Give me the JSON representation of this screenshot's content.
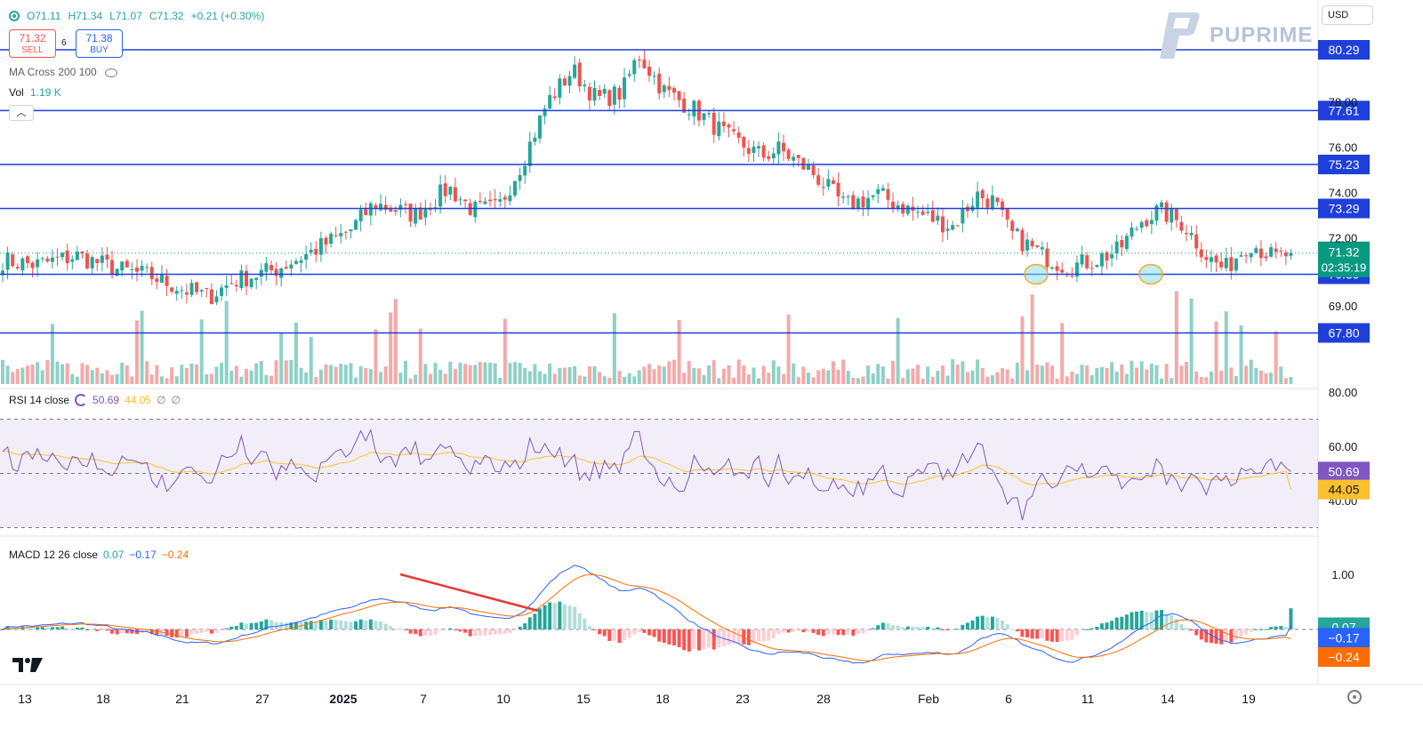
{
  "symbol_bar": {
    "ohlc": [
      "O71.11",
      "H71.34",
      "L71.07",
      "C71.32",
      "+0.21 (+0.30%)"
    ]
  },
  "trade": {
    "sell_price": "71.32",
    "sell_label": "SELL",
    "spread": "6",
    "buy_price": "71.38",
    "buy_label": "BUY"
  },
  "indicators": {
    "ma_cross": "MA Cross 200 100",
    "vol_label": "Vol",
    "vol_value": "1.19 K"
  },
  "rsi_legend": {
    "name": "RSI 14 close",
    "rsi": "50.69",
    "ma": "44.05",
    "a": "∅",
    "b": "∅"
  },
  "macd_legend": {
    "name": "MACD 12 26 close",
    "macd": "0.07",
    "signal": "−0.17",
    "hist": "−0.24"
  },
  "brand": {
    "name": "PUPRIME"
  },
  "currency": "USD",
  "colors": {
    "up": "#26a69a",
    "down": "#ef5350",
    "level": "#1e3fd9",
    "rsi": "#7e57c2",
    "rsi_ma": "#fbc02d",
    "macd": "#2962ff",
    "signal": "#ff6d00",
    "price_tag": "#089981"
  },
  "chart_data": {
    "type": "candlestick",
    "price_axis_ticks": [
      "78.00",
      "76.00",
      "74.00",
      "72.00",
      "69.00"
    ],
    "levels": [
      {
        "price": 80.29,
        "label": "80.29"
      },
      {
        "price": 77.61,
        "label": "77.61"
      },
      {
        "price": 75.23,
        "label": "75.23"
      },
      {
        "price": 73.29,
        "label": "73.29"
      },
      {
        "price": 70.39,
        "label": "70.39"
      },
      {
        "price": 67.8,
        "label": "67.80"
      }
    ],
    "current_price": {
      "price": 71.32,
      "label": "71.32",
      "countdown": "02:35:19"
    },
    "x_axis_ticks": [
      "13",
      "18",
      "21",
      "27",
      "2025",
      "7",
      "10",
      "15",
      "18",
      "23",
      "28",
      "Feb",
      "6",
      "11",
      "14",
      "19"
    ],
    "close_waypoints": [
      [
        0,
        71.0
      ],
      [
        20,
        70.8
      ],
      [
        45,
        71.2
      ],
      [
        70,
        70.6
      ],
      [
        90,
        70.3
      ],
      [
        110,
        69.7
      ],
      [
        125,
        69.4
      ],
      [
        140,
        70.1
      ],
      [
        165,
        70.6
      ],
      [
        185,
        71.3
      ],
      [
        210,
        72.3
      ],
      [
        225,
        73.5
      ],
      [
        250,
        73.0
      ],
      [
        270,
        74.2
      ],
      [
        285,
        73.2
      ],
      [
        300,
        73.3
      ],
      [
        315,
        75.4
      ],
      [
        330,
        78.0
      ],
      [
        345,
        79.4
      ],
      [
        360,
        78.1
      ],
      [
        375,
        78.4
      ],
      [
        385,
        80.1
      ],
      [
        400,
        78.5
      ],
      [
        420,
        77.6
      ],
      [
        440,
        76.4
      ],
      [
        460,
        75.6
      ],
      [
        470,
        75.9
      ],
      [
        490,
        74.9
      ],
      [
        510,
        73.4
      ],
      [
        530,
        73.9
      ],
      [
        550,
        73.2
      ],
      [
        575,
        72.5
      ],
      [
        590,
        73.9
      ],
      [
        600,
        73.6
      ],
      [
        610,
        72.2
      ],
      [
        630,
        71.2
      ],
      [
        645,
        70.7
      ],
      [
        660,
        71.0
      ],
      [
        675,
        71.4
      ],
      [
        690,
        72.8
      ],
      [
        700,
        73.2
      ],
      [
        715,
        72.6
      ],
      [
        730,
        71.1
      ],
      [
        740,
        70.6
      ],
      [
        755,
        71.8
      ],
      [
        770,
        71.1
      ],
      [
        780,
        71.3
      ]
    ],
    "rsi_panel": {
      "ticks": [
        "80.00",
        "60.00",
        "40.00"
      ],
      "rsi_value": 50.69,
      "rsi_ma_value": 44.05,
      "upper_band": 70,
      "mid_band": 50,
      "lower_band": 30
    },
    "macd_panel": {
      "ticks": [
        "1.00"
      ],
      "macd_value": 0.07,
      "signal_value": -0.17,
      "hist_value": -0.24
    }
  }
}
